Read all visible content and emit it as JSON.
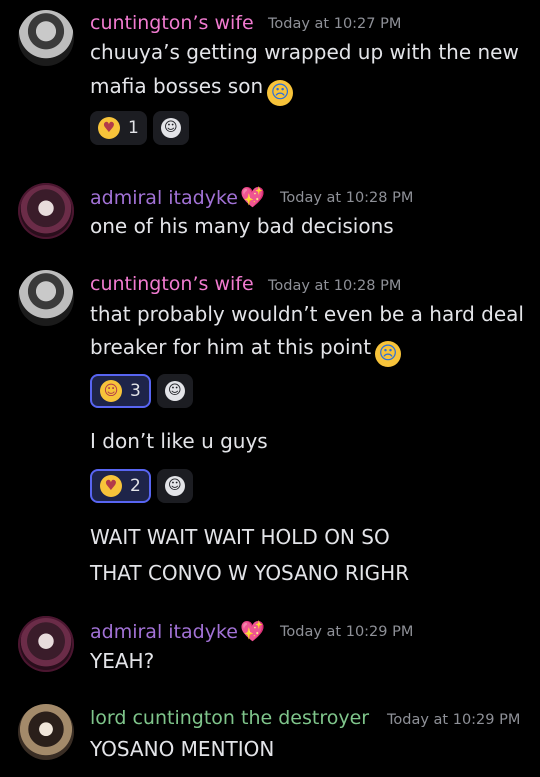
{
  "messages": [
    {
      "author": "cuntington’s wife",
      "timestamp": "Today at 10:27 PM",
      "lines": [
        "chuuya’s getting wrapped up with the new",
        "mafia bosses son"
      ],
      "reactions": [
        {
          "emoji": "smiling-face-with-hearts",
          "count": "1"
        }
      ]
    },
    {
      "author": "admiral itadyke",
      "timestamp": "Today at 10:28 PM",
      "lines": [
        "one of his many bad decisions"
      ]
    },
    {
      "author": "cuntington’s wife",
      "timestamp": "Today at 10:28 PM",
      "lines": [
        "that probably wouldn’t even be a hard deal",
        "breaker for him at this point"
      ],
      "reactions": [
        {
          "emoji": "smiling-face",
          "count": "3"
        }
      ],
      "followups": [
        {
          "text": "I don’t like u guys",
          "reactions": [
            {
              "emoji": "face-blowing-kiss",
              "count": "2"
            }
          ]
        },
        {
          "text": "WAIT WAIT WAIT HOLD ON SO"
        },
        {
          "text": "THAT CONVO W YOSANO RIGHR"
        }
      ]
    },
    {
      "author": "admiral itadyke",
      "timestamp": "Today at 10:29 PM",
      "lines": [
        "YEAH?"
      ]
    },
    {
      "author": "lord cuntington the destroyer",
      "timestamp": "Today at 10:29 PM",
      "lines": [
        "YOSANO MENTION"
      ]
    }
  ],
  "colors": {
    "background": "#000000",
    "wife_name": "#f17bd0",
    "admiral_name": "#a272d6",
    "lord_name": "#7fc58b",
    "active_reaction_border": "#5865f2"
  }
}
